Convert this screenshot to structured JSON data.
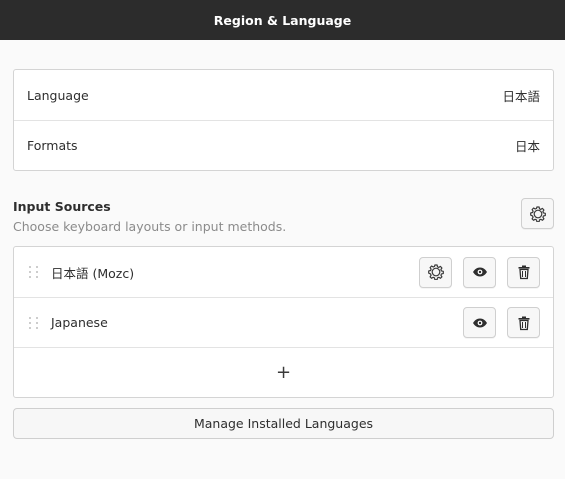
{
  "window": {
    "title": "Region & Language"
  },
  "region": {
    "language_label": "Language",
    "language_value": "日本語",
    "formats_label": "Formats",
    "formats_value": "日本"
  },
  "input_sources": {
    "title": "Input Sources",
    "subtitle": "Choose keyboard layouts or input methods.",
    "options_icon": "gear-icon",
    "items": [
      {
        "label": "日本語 (Mozc)",
        "icons": [
          "gear-icon",
          "eye-icon",
          "trash-icon"
        ]
      },
      {
        "label": "Japanese",
        "icons": [
          "eye-icon",
          "trash-icon"
        ]
      }
    ],
    "add_symbol": "+"
  },
  "manage_button_label": "Manage Installed Languages",
  "colors": {
    "titlebar": "#2c2c2c",
    "background": "#fafafa",
    "panel": "#ffffff",
    "border": "#d4d4d4",
    "subtitle": "#8b8b8b"
  }
}
